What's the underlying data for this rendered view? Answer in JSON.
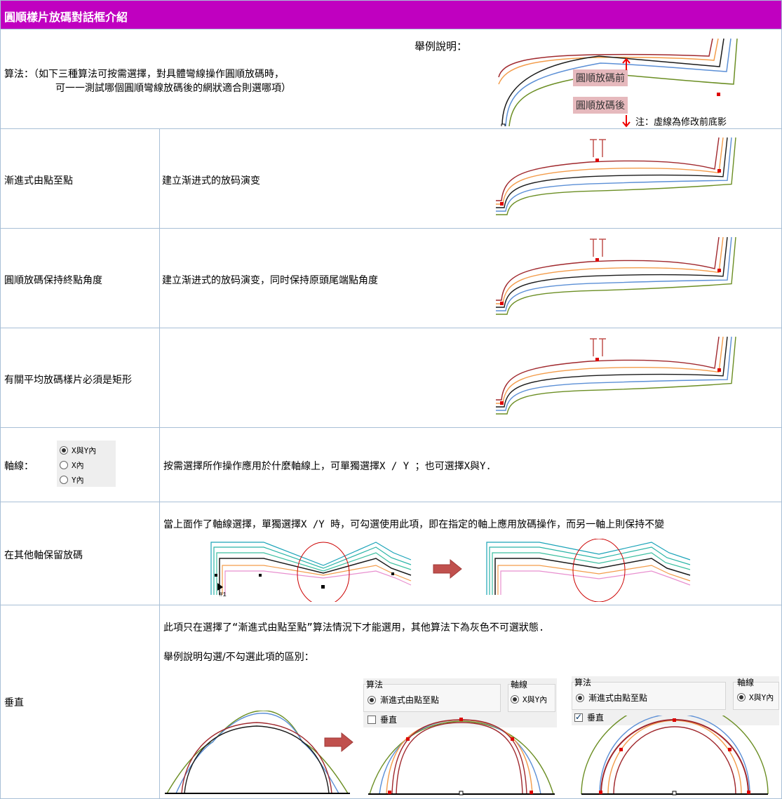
{
  "title": "圓順樣片放碼對話框介紹",
  "intro": {
    "label": "算法：（如下三種算法可按需選擇，對具體彎線操作圓順放碼時，",
    "label2": "可一一測試哪個圓順彎線放碼後的網狀適合則選哪項）",
    "example_title": "舉例說明：",
    "tag_before": "圓順放碼前",
    "tag_after": "圓順放碼後",
    "note": "注：虛線為修改前底影"
  },
  "rows": [
    {
      "label": "漸進式由點至點",
      "desc": "建立渐进式的放码演变"
    },
    {
      "label": "圓順放碼保持終點角度",
      "desc": "建立渐进式的放码演变，同时保持原頭尾端點角度"
    },
    {
      "label": "有關平均放碼樣片必須是矩形",
      "desc": ""
    }
  ],
  "axis": {
    "label": "軸線：",
    "options": [
      "X與Y內",
      "X內",
      "Y內"
    ],
    "selected": "X與Y內",
    "desc": "按需選擇所作操作應用於什麼軸線上，可單獨選擇X / Y ；也可選擇X與Y."
  },
  "keep": {
    "label": "在其他軸保留放碼",
    "desc": "當上面作了軸線選擇，單獨選擇X /Y 時，可勾選使用此項，即在指定的軸上應用放碼操作，而另一軸上則保持不變",
    "point_label": "#1"
  },
  "vertical": {
    "label": "垂直",
    "desc1": "此項只在選擇了“漸進式由點至點”算法情況下才能選用，其他算法下為灰色不可選狀態.",
    "desc2": "舉例說明勾選/不勾選此項的區別：",
    "panel_algo": "算法",
    "panel_axis": "軸線",
    "panel_option": "漸進式由點至點",
    "panel_axis_opt": "X與Y內",
    "panel_vertical": "垂直",
    "left_checked": false,
    "right_checked": true
  },
  "colors": {
    "header_bg": "#c000c0",
    "grid": "#a8bfd6",
    "tag": "#e6b9bd",
    "arrow": "#c0504d",
    "size_lines": [
      "#a0282d",
      "#f39c4a",
      "#1a1a1a",
      "#5b8fd6",
      "#6b8e23"
    ]
  }
}
